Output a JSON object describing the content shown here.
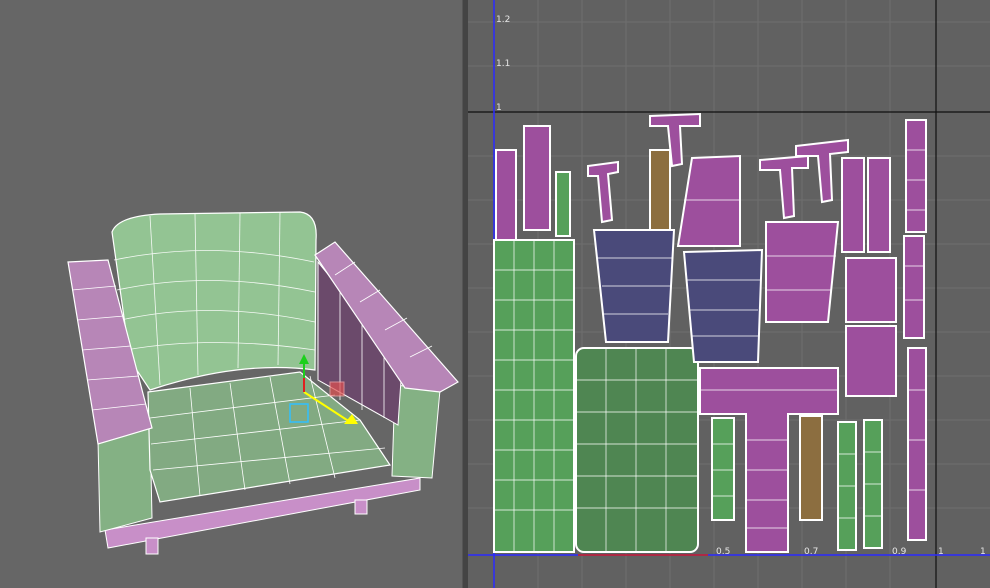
{
  "left_viewport": {
    "name": "3D perspective viewport",
    "model": "armchair",
    "gizmo_icons": [
      "move-manipulator-icon",
      "scale-handle-icon"
    ]
  },
  "uv_editor": {
    "axis_labels_y": [
      "1.2",
      "1.1",
      "1"
    ],
    "axis_labels_x": [
      "0.5",
      "0.7",
      "0.9",
      "1",
      "1"
    ],
    "colors": {
      "green": "#56a05a",
      "dark_green": "#4f8652",
      "purple": "#9d4f9d",
      "indigo": "#4a4a7a",
      "brown": "#8c6e40",
      "wire": "#ffffff",
      "axis": "#2a2aff",
      "grid": "#6c6c6c"
    }
  }
}
